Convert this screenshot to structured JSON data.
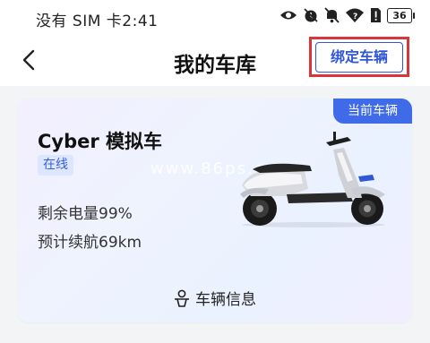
{
  "status_bar": {
    "carrier": "没有 SIM 卡",
    "time": "2:41",
    "battery_level": "36",
    "icons": [
      "eye-icon",
      "alarm-off-icon",
      "bell-off-icon",
      "wifi-question-icon",
      "sim-alert-icon",
      "battery-icon"
    ]
  },
  "header": {
    "title": "我的车库",
    "bind_button": "绑定车辆",
    "highlight_color": "#d7363a",
    "accent_color": "#2f57d8"
  },
  "vehicle_card": {
    "current_badge": "当前车辆",
    "name": "Cyber 模拟车",
    "status": "在线",
    "watermark": "www.86ps.com",
    "battery_text": "剩余电量99%",
    "range_text": "预计续航69km",
    "battery_percent": 99,
    "range_km": 69,
    "info_label": "车辆信息"
  }
}
